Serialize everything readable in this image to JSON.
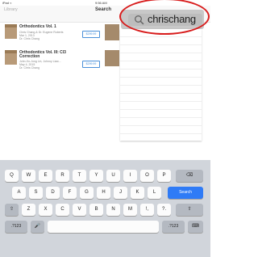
{
  "status": {
    "left": "iPad ≈",
    "center": "9:56 AM"
  },
  "nav": {
    "library": "Library",
    "title": "Search"
  },
  "search": {
    "value": "chrischang"
  },
  "results": [
    {
      "title1": "Orthodontics Vol. 1",
      "title2": "",
      "author": "Chris Chang & Dr. Eugene Roberts",
      "date": "Mar 1, 2013",
      "extra": "Dr. Chris Chang",
      "price": "$299.99"
    },
    {
      "title1": "Orthodontics Vol. III: Cl3",
      "title2": "Correction",
      "author": "John Jin-Jong Lin, Johnny Liaw…",
      "date": "May 4, 2015",
      "extra": "Dr. Chris Chang",
      "price": "$299.99"
    }
  ],
  "keyboard": {
    "row1": [
      "Q",
      "W",
      "E",
      "R",
      "T",
      "Y",
      "U",
      "I",
      "O",
      "P",
      "⌫"
    ],
    "row2": [
      "A",
      "S",
      "D",
      "F",
      "G",
      "H",
      "J",
      "K",
      "L",
      "Search"
    ],
    "row3": [
      "⇧",
      "Z",
      "X",
      "C",
      "V",
      "B",
      "N",
      "M",
      "!,",
      "?.",
      "⇧"
    ],
    "row4": [
      ".?123",
      "🎤",
      "",
      ".?123",
      "⌨"
    ]
  }
}
